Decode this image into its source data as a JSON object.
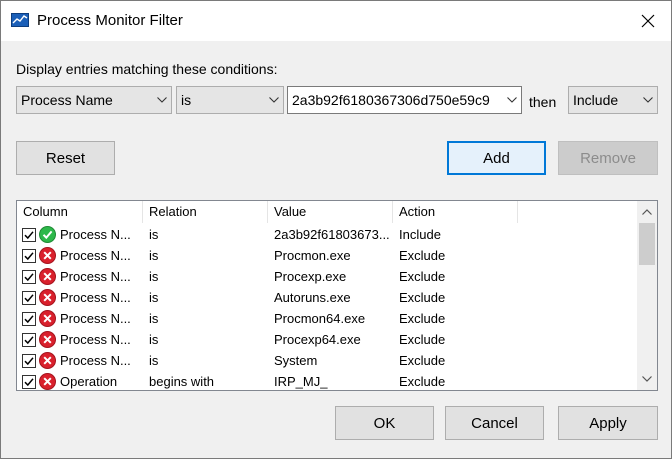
{
  "window": {
    "title": "Process Monitor Filter"
  },
  "prompt": "Display entries matching these conditions:",
  "filter": {
    "column": "Process Name",
    "relation": "is",
    "value": "2a3b92f6180367306d750e59c9",
    "then_label": "then",
    "action": "Include"
  },
  "buttons": {
    "reset": "Reset",
    "add": "Add",
    "remove": "Remove",
    "ok": "OK",
    "cancel": "Cancel",
    "apply": "Apply"
  },
  "list": {
    "headers": [
      "Column",
      "Relation",
      "Value",
      "Action"
    ],
    "rows": [
      {
        "column": "Process N...",
        "relation": "is",
        "value": "2a3b92f61803673...",
        "action": "Include",
        "checked": true,
        "status": "include-icon"
      },
      {
        "column": "Process N...",
        "relation": "is",
        "value": "Procmon.exe",
        "action": "Exclude",
        "checked": true,
        "status": "exclude-icon"
      },
      {
        "column": "Process N...",
        "relation": "is",
        "value": "Procexp.exe",
        "action": "Exclude",
        "checked": true,
        "status": "exclude-icon"
      },
      {
        "column": "Process N...",
        "relation": "is",
        "value": "Autoruns.exe",
        "action": "Exclude",
        "checked": true,
        "status": "exclude-icon"
      },
      {
        "column": "Process N...",
        "relation": "is",
        "value": "Procmon64.exe",
        "action": "Exclude",
        "checked": true,
        "status": "exclude-icon"
      },
      {
        "column": "Process N...",
        "relation": "is",
        "value": "Procexp64.exe",
        "action": "Exclude",
        "checked": true,
        "status": "exclude-icon"
      },
      {
        "column": "Process N...",
        "relation": "is",
        "value": "System",
        "action": "Exclude",
        "checked": true,
        "status": "exclude-icon"
      },
      {
        "column": "Operation",
        "relation": "begins with",
        "value": "IRP_MJ_",
        "action": "Exclude",
        "checked": true,
        "status": "exclude-icon"
      }
    ]
  },
  "colors": {
    "accent": "#0078d7",
    "include": "#2db84a",
    "exclude": "#d9202c"
  }
}
